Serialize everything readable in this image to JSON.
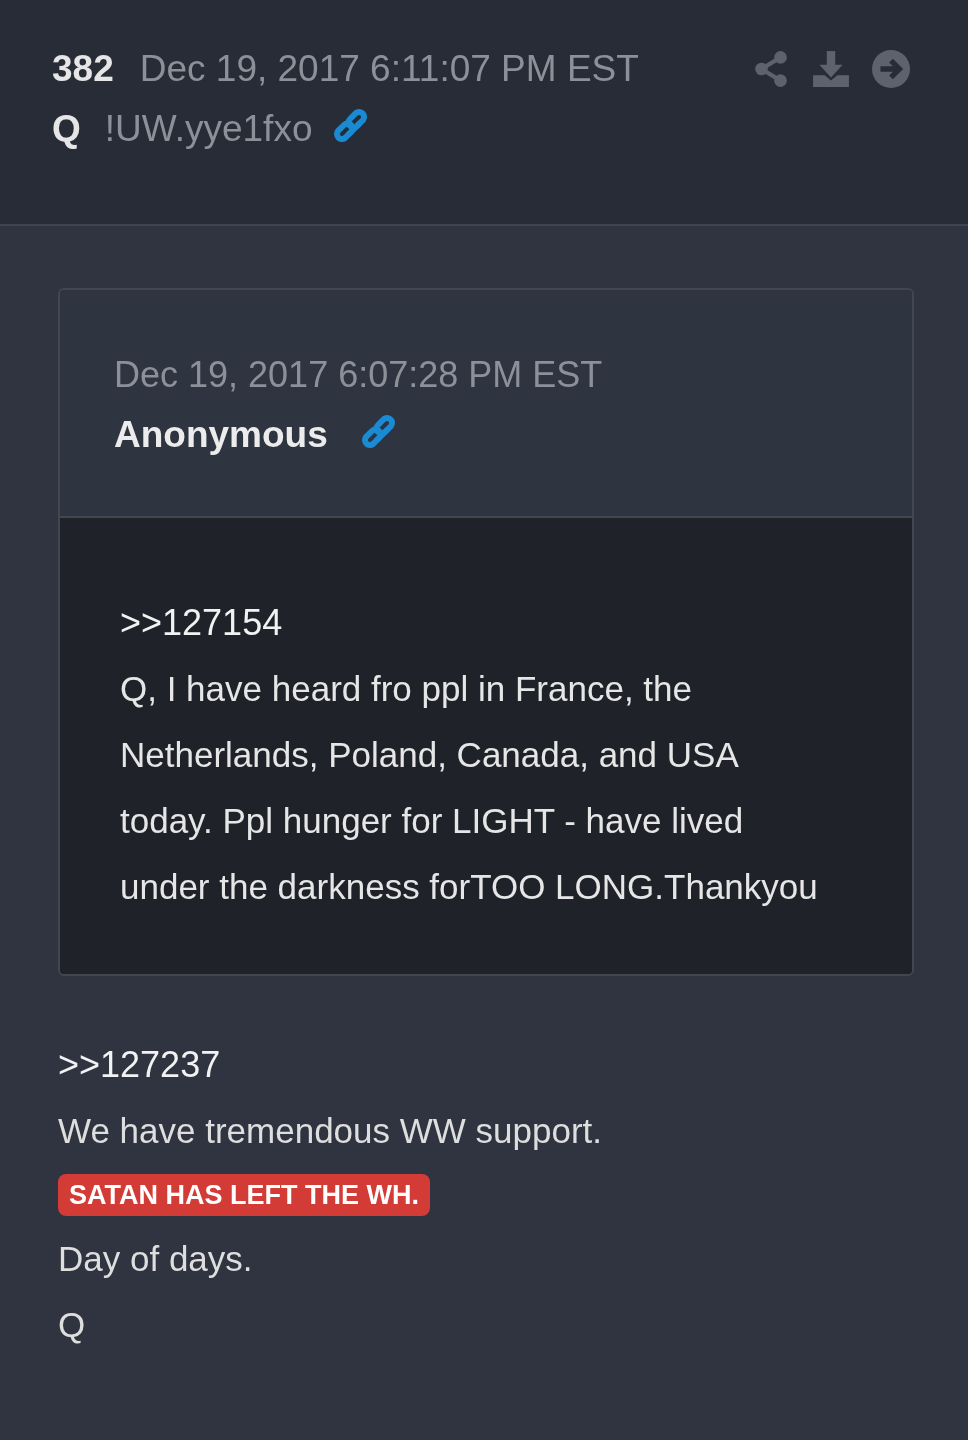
{
  "post": {
    "number": "382",
    "timestamp": "Dec 19, 2017 6:11:07 PM EST",
    "author": "Q",
    "tripcode": "!UW.yye1fxo"
  },
  "quoted_post": {
    "timestamp": "Dec 19, 2017 6:07:28 PM EST",
    "author": "Anonymous",
    "lines": [
      {
        "kind": "ref",
        "text": ">>127154"
      },
      {
        "kind": "text",
        "text": "Q, I have heard fro ppl in France, the Netherlands, Poland, Canada, and USA today.  Ppl hunger for LIGHT - have lived under the darkness forTOO LONG.Thankyou"
      }
    ]
  },
  "body": [
    {
      "kind": "ref",
      "text": " >>127237"
    },
    {
      "kind": "text",
      "text": "We have tremendous WW support."
    },
    {
      "kind": "highlight",
      "text": "SATAN HAS LEFT THE WH.",
      "color": "#d33b36"
    },
    {
      "kind": "text",
      "text": "Day of days."
    },
    {
      "kind": "text",
      "text": "Q"
    }
  ]
}
